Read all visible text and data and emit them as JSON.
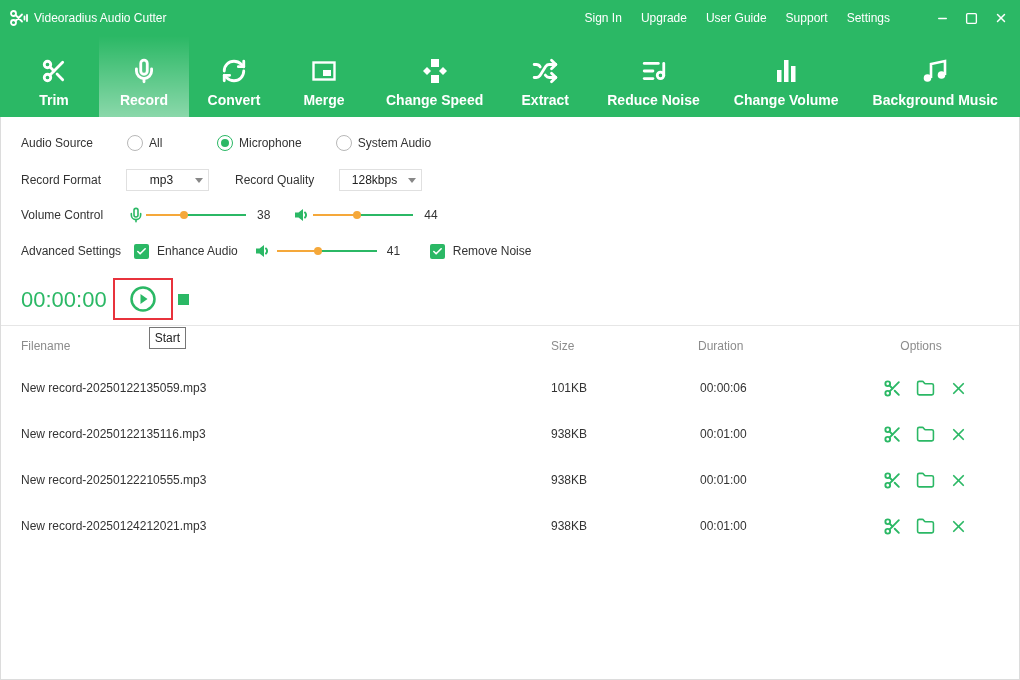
{
  "window": {
    "title": "Videoradius Audio Cutter",
    "menu": [
      "Sign In",
      "Upgrade",
      "User Guide",
      "Support",
      "Settings"
    ]
  },
  "toolbar": {
    "tabs": [
      {
        "label": "Trim",
        "selected": false
      },
      {
        "label": "Record",
        "selected": true
      },
      {
        "label": "Convert",
        "selected": false
      },
      {
        "label": "Merge",
        "selected": false
      },
      {
        "label": "Change Speed",
        "selected": false
      },
      {
        "label": "Extract",
        "selected": false
      },
      {
        "label": "Reduce Noise",
        "selected": false
      },
      {
        "label": "Change Volume",
        "selected": false
      },
      {
        "label": "Background Music",
        "selected": false
      }
    ]
  },
  "audio_source": {
    "label": "Audio Source",
    "options": [
      {
        "label": "All",
        "selected": false
      },
      {
        "label": "Microphone",
        "selected": true
      },
      {
        "label": "System Audio",
        "selected": false
      }
    ]
  },
  "record_format": {
    "label": "Record Format",
    "value": "mp3"
  },
  "record_quality": {
    "label": "Record Quality",
    "value": "128kbps"
  },
  "volume_control": {
    "label": "Volume Control",
    "sliders": [
      {
        "level": 0.38,
        "reading": "38"
      },
      {
        "level": 0.44,
        "reading": "44"
      }
    ]
  },
  "advanced_settings": {
    "label": "Advanced Settings",
    "enhance_audio": {
      "label": "Enhance Audio",
      "checked": true
    },
    "slider": {
      "level": 0.41,
      "reading": "41"
    },
    "remove_noise": {
      "label": "Remove Noise",
      "checked": true
    }
  },
  "recorder": {
    "time": "00:00:00",
    "start_button": {
      "highlighted": true,
      "tooltip": "Start"
    }
  },
  "table": {
    "columns": [
      "Filename",
      "Size",
      "Duration",
      "Options"
    ],
    "rows": [
      {
        "filename": "New record-20250122135059.mp3",
        "size": "101KB",
        "duration": "00:00:06"
      },
      {
        "filename": "New record-20250122135116.mp3",
        "size": "938KB",
        "duration": "00:01:00"
      },
      {
        "filename": "New record-20250122210555.mp3",
        "size": "938KB",
        "duration": "00:01:00"
      },
      {
        "filename": "New record-20250124212021.mp3",
        "size": "938KB",
        "duration": "00:01:00"
      }
    ]
  }
}
